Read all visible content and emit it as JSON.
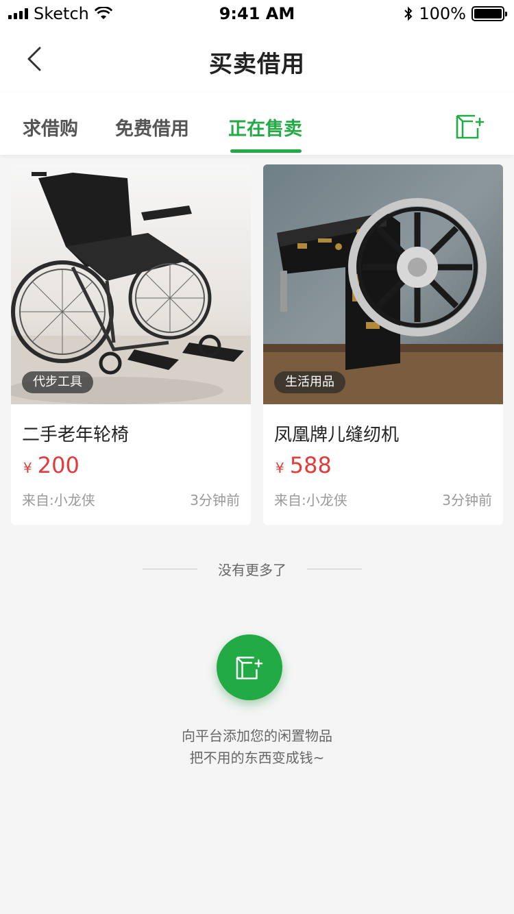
{
  "status_bar": {
    "carrier": "Sketch",
    "time": "9:41 AM",
    "battery": "100%"
  },
  "nav": {
    "title": "买卖借用"
  },
  "tabs": [
    {
      "label": "求借购",
      "active": false
    },
    {
      "label": "免费借用",
      "active": false
    },
    {
      "label": "正在售卖",
      "active": true
    }
  ],
  "items": [
    {
      "badge": "代步工具",
      "title": "二手老年轮椅",
      "currency": "¥",
      "price": "200",
      "from": "来自:小龙侠",
      "time": "3分钟前"
    },
    {
      "badge": "生活用品",
      "title": "凤凰牌儿缝纫机",
      "currency": "¥",
      "price": "588",
      "from": "来自:小龙侠",
      "time": "3分钟前"
    }
  ],
  "footer": {
    "no_more": "没有更多了",
    "hint_line1": "向平台添加您的闲置物品",
    "hint_line2": "把不用的东西变成钱~"
  },
  "colors": {
    "accent": "#22aa44",
    "price": "#e23b3b"
  }
}
